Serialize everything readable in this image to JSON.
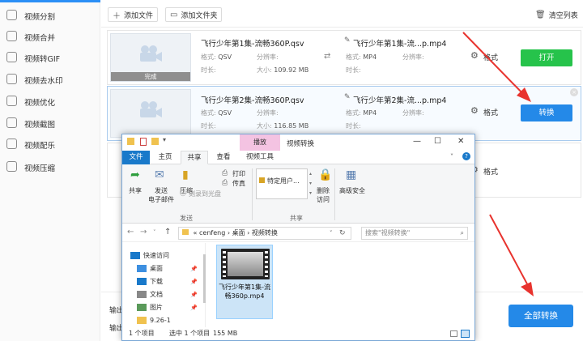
{
  "sidebar": {
    "items": [
      {
        "label": "视频分割",
        "icon": "scissors-icon"
      },
      {
        "label": "视频合并",
        "icon": "merge-icon"
      },
      {
        "label": "视频转GIF",
        "icon": "gif-icon"
      },
      {
        "label": "视频去水印",
        "icon": "watermark-icon"
      },
      {
        "label": "视频优化",
        "icon": "optimize-icon"
      },
      {
        "label": "视频截图",
        "icon": "screenshot-icon"
      },
      {
        "label": "视频配乐",
        "icon": "music-icon"
      },
      {
        "label": "视频压缩",
        "icon": "compress-icon"
      }
    ]
  },
  "toolbar": {
    "add_file": "添加文件",
    "add_folder": "添加文件夹",
    "clear_list": "清空列表"
  },
  "rows": [
    {
      "src_name": "飞行少年第1集-流畅360P.qsv",
      "format_label": "格式:",
      "format": "QSV",
      "resolution_label": "分辨率:",
      "resolution": "",
      "duration_label": "时长:",
      "size_label": "大小:",
      "size": "109.92 MB",
      "out_name": "飞行少年第1集-流...p.mp4",
      "out_format": "MP4",
      "out_resolution_label": "分辨率:",
      "out_duration_label": "时长:",
      "settings_label": "格式",
      "thumb_badge": "完成",
      "action": "打开"
    },
    {
      "src_name": "飞行少年第2集-流畅360P.qsv",
      "format_label": "格式:",
      "format": "QSV",
      "resolution_label": "分辨率:",
      "resolution": "",
      "duration_label": "时长:",
      "size_label": "大小:",
      "size": "116.85 MB",
      "out_name": "飞行少年第2集-流...p.mp4",
      "out_format": "MP4",
      "out_resolution_label": "分辨率:",
      "out_duration_label": "时长:",
      "settings_label": "格式",
      "action": "转换"
    },
    {
      "settings_label": "格式"
    }
  ],
  "bottom": {
    "output_label_1": "输出",
    "output_label_2": "输出",
    "convert_all": "全部转换"
  },
  "explorer": {
    "ctx_tab": "播放",
    "title": "视频转换",
    "tabs": [
      "文件",
      "主页",
      "共享",
      "查看",
      "视频工具"
    ],
    "ribbon": {
      "share": "共享",
      "email": "发送\n电子邮件",
      "zip": "压缩",
      "print": "打印",
      "fax": "传真",
      "burn": "刻录到光盘",
      "send_group": "发送",
      "specific_users": "特定用户...",
      "remove_access": "删除\n访问",
      "advanced_security": "高级安全",
      "share_group": "共享"
    },
    "address": {
      "path_parts": [
        "«",
        "cenfeng",
        "›",
        "桌面",
        "›",
        "视频转换"
      ],
      "search_placeholder": "搜索\"视频转换\""
    },
    "nav": [
      {
        "label": "快速访问",
        "pinned": false
      },
      {
        "label": "桌面",
        "pinned": true
      },
      {
        "label": "下载",
        "pinned": true
      },
      {
        "label": "文档",
        "pinned": true
      },
      {
        "label": "图片",
        "pinned": true
      },
      {
        "label": "9.26-1",
        "pinned": false
      }
    ],
    "file": {
      "name": "飞行少年第1集-流畅360p.mp4"
    },
    "status": {
      "count": "1 个项目",
      "selected": "选中 1 个项目",
      "size": "155 MB"
    }
  },
  "colors": {
    "accent": "#2489e8",
    "open_button": "#26c34b",
    "arrow": "#e8332e"
  }
}
